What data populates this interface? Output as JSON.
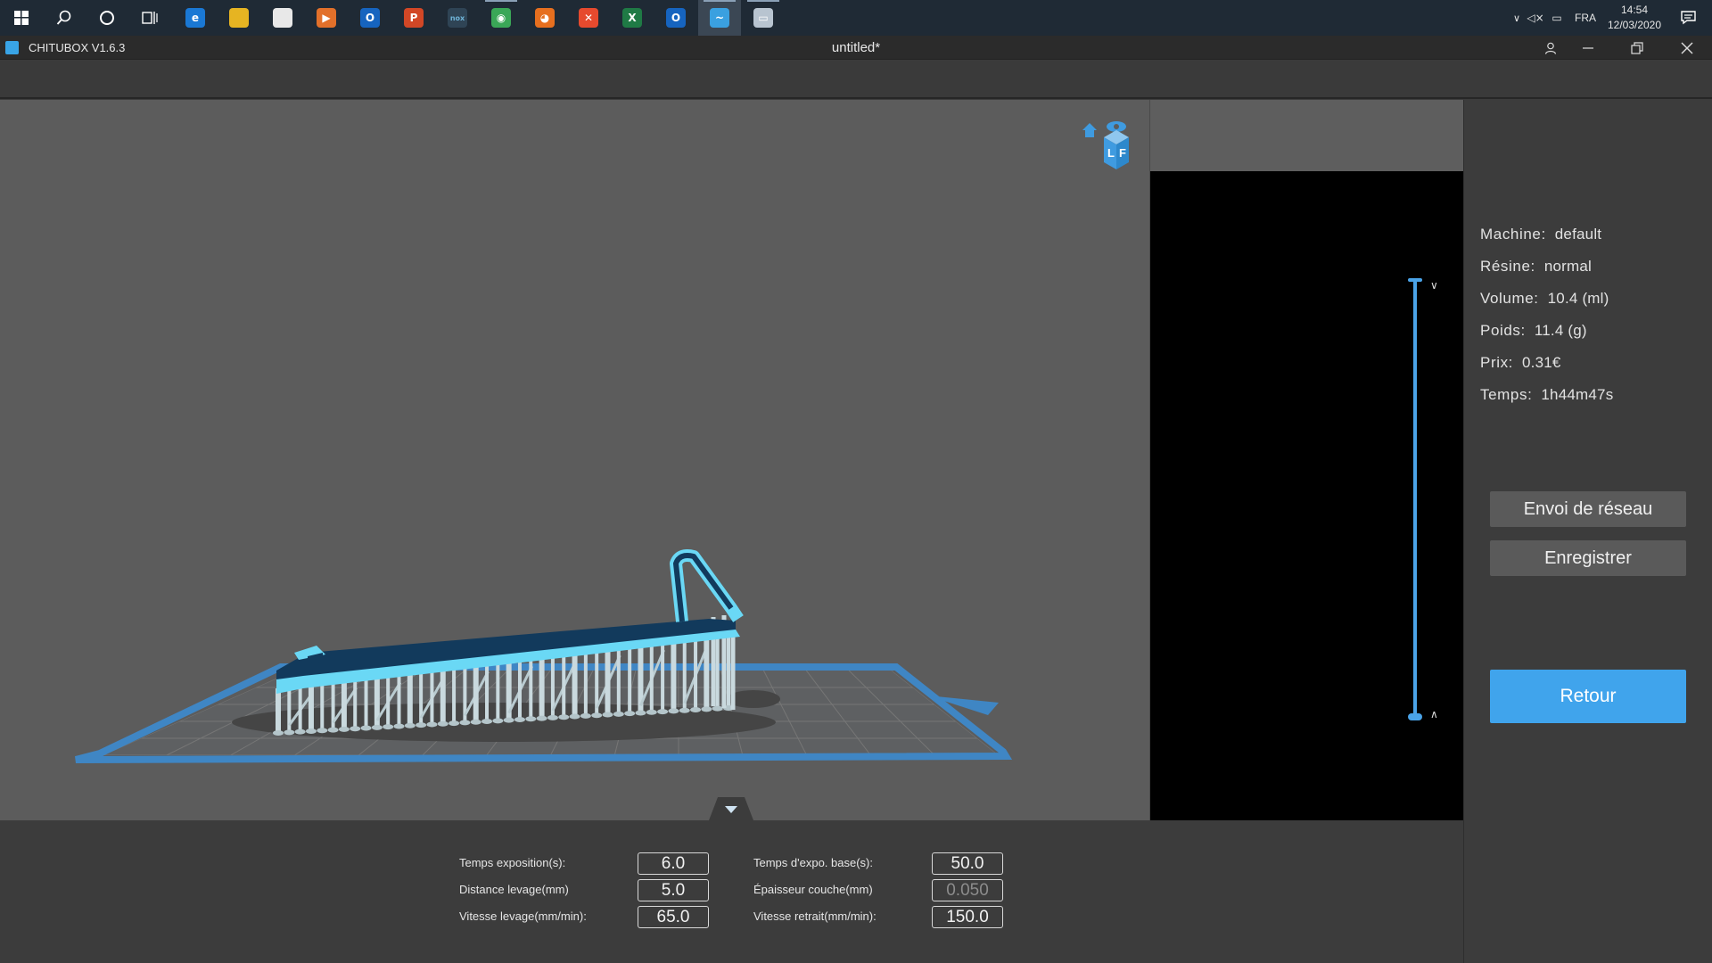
{
  "taskbar": {
    "language": "FRA",
    "time": "14:54",
    "date": "12/03/2020",
    "apps": [
      {
        "name": "edge",
        "color": "#1a78d4",
        "glyph": "e"
      },
      {
        "name": "file-explorer",
        "color": "#e6b422",
        "glyph": ""
      },
      {
        "name": "store",
        "color": "#e8e8e8",
        "glyph": ""
      },
      {
        "name": "media",
        "color": "#e2702a",
        "glyph": "▶"
      },
      {
        "name": "outlook",
        "color": "#1664bf",
        "glyph": "O"
      },
      {
        "name": "powerpoint",
        "color": "#d24726",
        "glyph": "P"
      },
      {
        "name": "nox",
        "color": "#2f4455",
        "glyph": "nox"
      },
      {
        "name": "chrome",
        "color": "#3aa757",
        "glyph": "◉"
      },
      {
        "name": "firefox",
        "color": "#e66f1f",
        "glyph": "◕"
      },
      {
        "name": "xmind",
        "color": "#e64a2e",
        "glyph": "✕"
      },
      {
        "name": "excel",
        "color": "#1f7a45",
        "glyph": "X"
      },
      {
        "name": "outlook-2",
        "color": "#1664bf",
        "glyph": "O"
      },
      {
        "name": "chitubox",
        "color": "#3aa0e0",
        "glyph": "~"
      },
      {
        "name": "misc-app",
        "color": "#b8c4d0",
        "glyph": "▭"
      }
    ]
  },
  "window": {
    "app_name": "CHITUBOX V1.6.3",
    "doc_title": "untitled*"
  },
  "stats": [
    {
      "label": "Machine:",
      "value": "default"
    },
    {
      "label": "Résine:",
      "value": "normal"
    },
    {
      "label": "Volume:",
      "value": "10.4  (ml)"
    },
    {
      "label": "Poids:",
      "value": "11.4  (g)"
    },
    {
      "label": "Prix:",
      "value": "0.31€"
    },
    {
      "label": "Temps:",
      "value": "1h44m47s"
    }
  ],
  "buttons": {
    "network": "Envoi de réseau",
    "save": "Enregistrer",
    "back": "Retour"
  },
  "params": {
    "exposure_label": "Temps exposition(s):",
    "exposure_value": "6.0",
    "lift_distance_label": "Distance levage(mm)",
    "lift_distance_value": "5.0",
    "lift_speed_label": "Vitesse levage(mm/min):",
    "lift_speed_value": "65.0",
    "base_exposure_label": "Temps d'expo. base(s):",
    "base_exposure_value": "50.0",
    "layer_thickness_label": "Épaisseur couche(mm)",
    "layer_thickness_value": "0.050",
    "retract_speed_label": "Vitesse retrait(mm/min):",
    "retract_speed_value": "150.0"
  },
  "viewcube": {
    "letters": [
      "L",
      "F"
    ]
  },
  "colors": {
    "accent": "#40a4ec",
    "plate_outline": "#3f86c4",
    "model_top": "#123a5c",
    "model_edge": "#6ad8f5",
    "supports": "#c9d9de",
    "shadow": "#454545"
  }
}
